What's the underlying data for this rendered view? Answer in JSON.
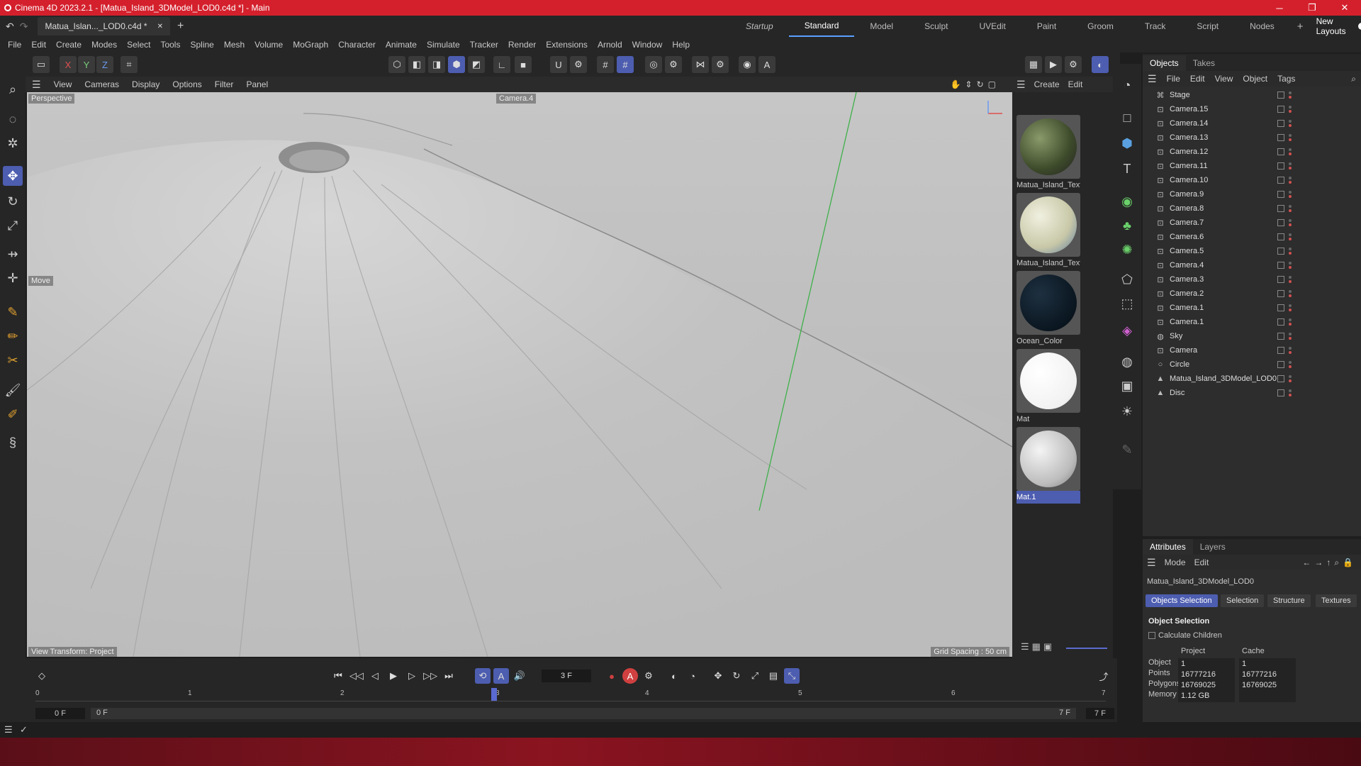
{
  "titlebar": {
    "title": "Cinema 4D 2023.2.1 - [Matua_Island_3DModel_LOD0.c4d *] - Main",
    "minimize": "─",
    "restore": "❐",
    "close": "✕"
  },
  "tabs": {
    "doc_tab": "Matua_Islan..._LOD0.c4d *",
    "close": "✕",
    "add": "+",
    "layouts": [
      "Startup",
      "Standard",
      "Model",
      "Sculpt",
      "UVEdit",
      "Paint",
      "Groom",
      "Track",
      "Script",
      "Nodes"
    ],
    "active_layout": "Standard",
    "add_layout": "+",
    "new_layouts": "New Layouts"
  },
  "menu": [
    "File",
    "Edit",
    "Create",
    "Modes",
    "Select",
    "Tools",
    "Spline",
    "Mesh",
    "Volume",
    "MoGraph",
    "Character",
    "Animate",
    "Simulate",
    "Tracker",
    "Render",
    "Extensions",
    "Arnold",
    "Window",
    "Help"
  ],
  "toolbar": {
    "axis_x": "X",
    "axis_y": "Y",
    "axis_z": "Z"
  },
  "viewport": {
    "menu": [
      "View",
      "Cameras",
      "Display",
      "Options",
      "Filter",
      "Panel"
    ],
    "projection": "Perspective",
    "camera": "Camera.4",
    "tool_label": "Move",
    "view_transform": "View Transform: Project",
    "grid_spacing": "Grid Spacing : 50 cm"
  },
  "materials": {
    "menu": [
      "Create",
      "Edit"
    ],
    "items": [
      {
        "name": "Matua_Island_Text"
      },
      {
        "name": "Matua_Island_Text"
      },
      {
        "name": "Ocean_Color"
      },
      {
        "name": "Mat"
      },
      {
        "name": "Mat.1"
      }
    ]
  },
  "objects": {
    "tabs": [
      "Objects",
      "Takes"
    ],
    "menu": [
      "File",
      "Edit",
      "View",
      "Object",
      "Tags"
    ],
    "items": [
      {
        "name": "Stage",
        "icon": "⌘"
      },
      {
        "name": "Camera.15",
        "icon": "⊡"
      },
      {
        "name": "Camera.14",
        "icon": "⊡"
      },
      {
        "name": "Camera.13",
        "icon": "⊡"
      },
      {
        "name": "Camera.12",
        "icon": "⊡"
      },
      {
        "name": "Camera.11",
        "icon": "⊡"
      },
      {
        "name": "Camera.10",
        "icon": "⊡"
      },
      {
        "name": "Camera.9",
        "icon": "⊡"
      },
      {
        "name": "Camera.8",
        "icon": "⊡"
      },
      {
        "name": "Camera.7",
        "icon": "⊡"
      },
      {
        "name": "Camera.6",
        "icon": "⊡"
      },
      {
        "name": "Camera.5",
        "icon": "⊡"
      },
      {
        "name": "Camera.4",
        "icon": "⊡"
      },
      {
        "name": "Camera.3",
        "icon": "⊡"
      },
      {
        "name": "Camera.2",
        "icon": "⊡"
      },
      {
        "name": "Camera.1",
        "icon": "⊡"
      },
      {
        "name": "Camera.1",
        "icon": "⊡"
      },
      {
        "name": "Sky",
        "icon": "◍"
      },
      {
        "name": "Camera",
        "icon": "⊡"
      },
      {
        "name": "Circle",
        "icon": "○"
      },
      {
        "name": "Matua_Island_3DModel_LOD0",
        "icon": "▲"
      },
      {
        "name": "Disc",
        "icon": "▲"
      }
    ]
  },
  "attributes": {
    "tabs": [
      "Attributes",
      "Layers"
    ],
    "menu": [
      "Mode",
      "Edit"
    ],
    "object_name": "Matua_Island_3DModel_LOD0",
    "subtabs": [
      "Objects Selection",
      "Selection",
      "Structure",
      "Textures"
    ],
    "active_subtab": "Objects Selection",
    "section_title": "Object Selection",
    "calc_children": "Calculate Children",
    "col_project": "Project",
    "col_cache": "Cache",
    "rows": [
      {
        "label": "Object",
        "project": "1",
        "cache": "1"
      },
      {
        "label": "Points",
        "project": "16777216",
        "cache": "16777216"
      },
      {
        "label": "Polygons",
        "project": "16769025",
        "cache": "16769025"
      },
      {
        "label": "Memory",
        "project": "1.12 GB",
        "cache": ""
      }
    ]
  },
  "timeline": {
    "current_frame": "3 F",
    "ticks": [
      "0",
      "1",
      "2",
      "3",
      "4",
      "5",
      "6",
      "7"
    ],
    "start_field": "0 F",
    "start_field2": "0 F",
    "end_field": "7 F",
    "end_field2": "7 F"
  },
  "colors": {
    "accent": "#4d5db0",
    "titlebar": "#d4202c"
  }
}
